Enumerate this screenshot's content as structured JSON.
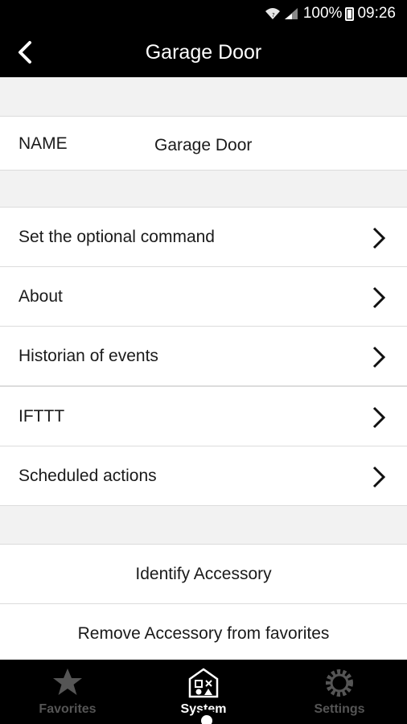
{
  "status_bar": {
    "battery": "100%",
    "time": "09:26"
  },
  "header": {
    "title": "Garage Door"
  },
  "name_field": {
    "label": "NAME",
    "value": "Garage Door"
  },
  "menu": [
    {
      "label": "Set the optional command"
    },
    {
      "label": "About"
    },
    {
      "label": "Historian of events"
    },
    {
      "label": "IFTTT"
    },
    {
      "label": "Scheduled actions"
    }
  ],
  "actions": {
    "identify": "Identify Accessory",
    "remove_favorite": "Remove Accessory from favorites"
  },
  "bottom_nav": [
    {
      "label": "Favorites",
      "icon": "star-icon",
      "active": false
    },
    {
      "label": "System",
      "icon": "house-icon",
      "active": true
    },
    {
      "label": "Settings",
      "icon": "gear-icon",
      "active": false
    }
  ],
  "colors": {
    "bar": "#000000",
    "background": "#f2f2f2",
    "inactive_tab": "#555555"
  }
}
